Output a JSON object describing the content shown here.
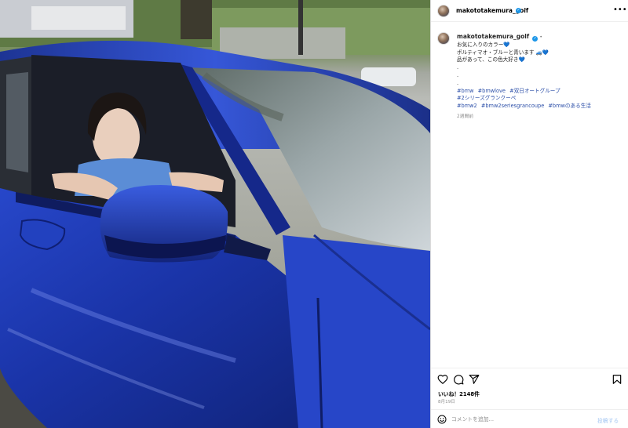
{
  "post": {
    "username": "makototakemura_golf",
    "caption_lines": [
      "お気に入りのカラー💙",
      "ポルティマオ・ブルーと青います 🚙💙",
      "品があって、この色大好き💙",
      ".",
      ".",
      "."
    ],
    "hashtags": [
      "#bmw",
      "#bmwlove",
      "#双日オートグループ",
      "#2シリーズグランクーペ",
      "#bmw2",
      "#bmw2seriesgrancoupe",
      "#bmwのある生活"
    ],
    "caption_age": "2週間前",
    "likes_label": "いいね！2148件",
    "date": "8月19日"
  },
  "comment": {
    "placeholder": "コメントを追加...",
    "post_label": "投稿する"
  },
  "icons": {
    "more": "more-options-icon",
    "like": "heart-icon",
    "comment": "comment-icon",
    "share": "share-icon",
    "save": "bookmark-icon",
    "emoji": "emoji-icon",
    "verified": "verified-badge-icon"
  },
  "colors": {
    "car_blue": "#1f3fb5",
    "hashtag": "#2c4fa8",
    "verified": "#1c96e8",
    "post_button": "#a3c6f2"
  }
}
